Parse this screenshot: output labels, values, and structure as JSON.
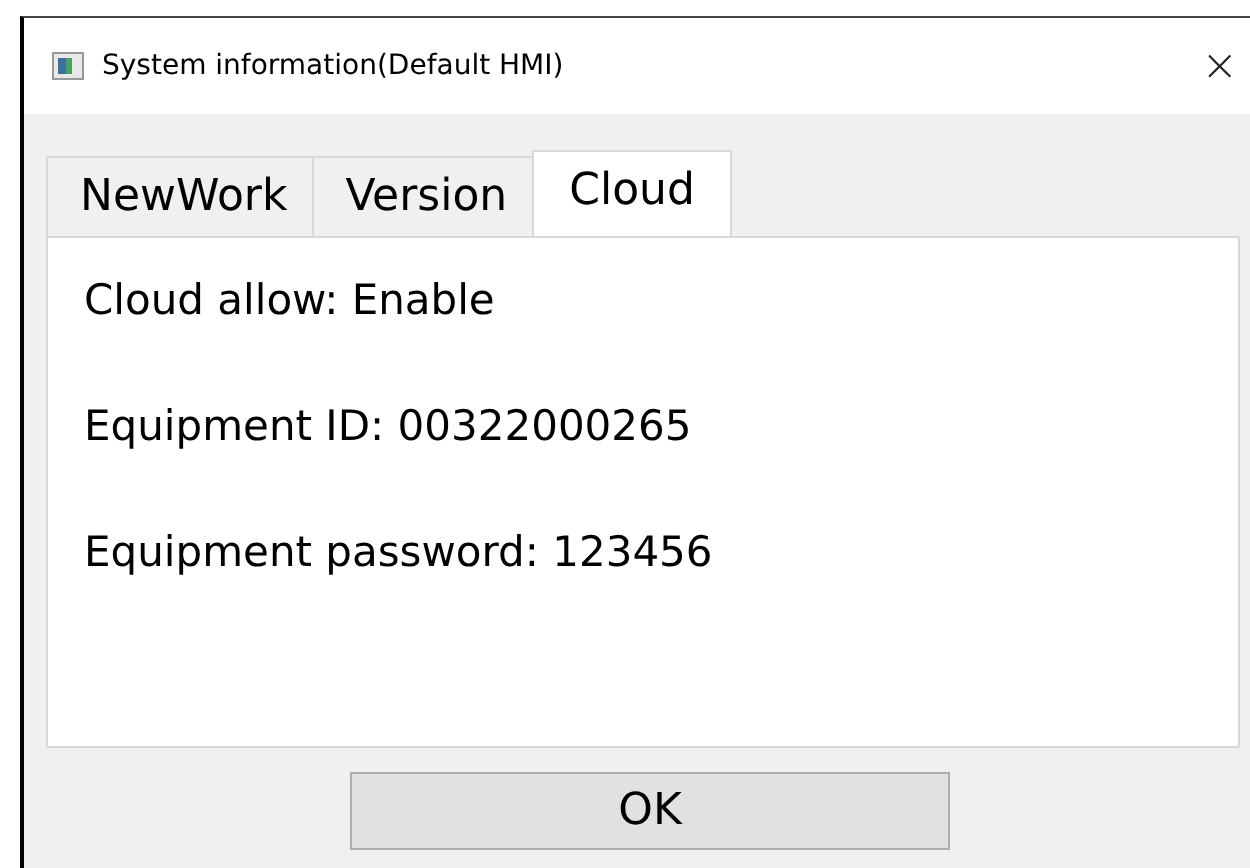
{
  "window": {
    "title": "System information(Default HMI)",
    "close": "×"
  },
  "tabs": [
    {
      "label": "NewWork",
      "selected": false
    },
    {
      "label": "Version",
      "selected": false
    },
    {
      "label": "Cloud",
      "selected": true
    }
  ],
  "lines": [
    "Cloud allow: Enable",
    "Equipment ID: 00322000265",
    "Equipment password: 123456"
  ],
  "buttons": [
    "OK"
  ]
}
